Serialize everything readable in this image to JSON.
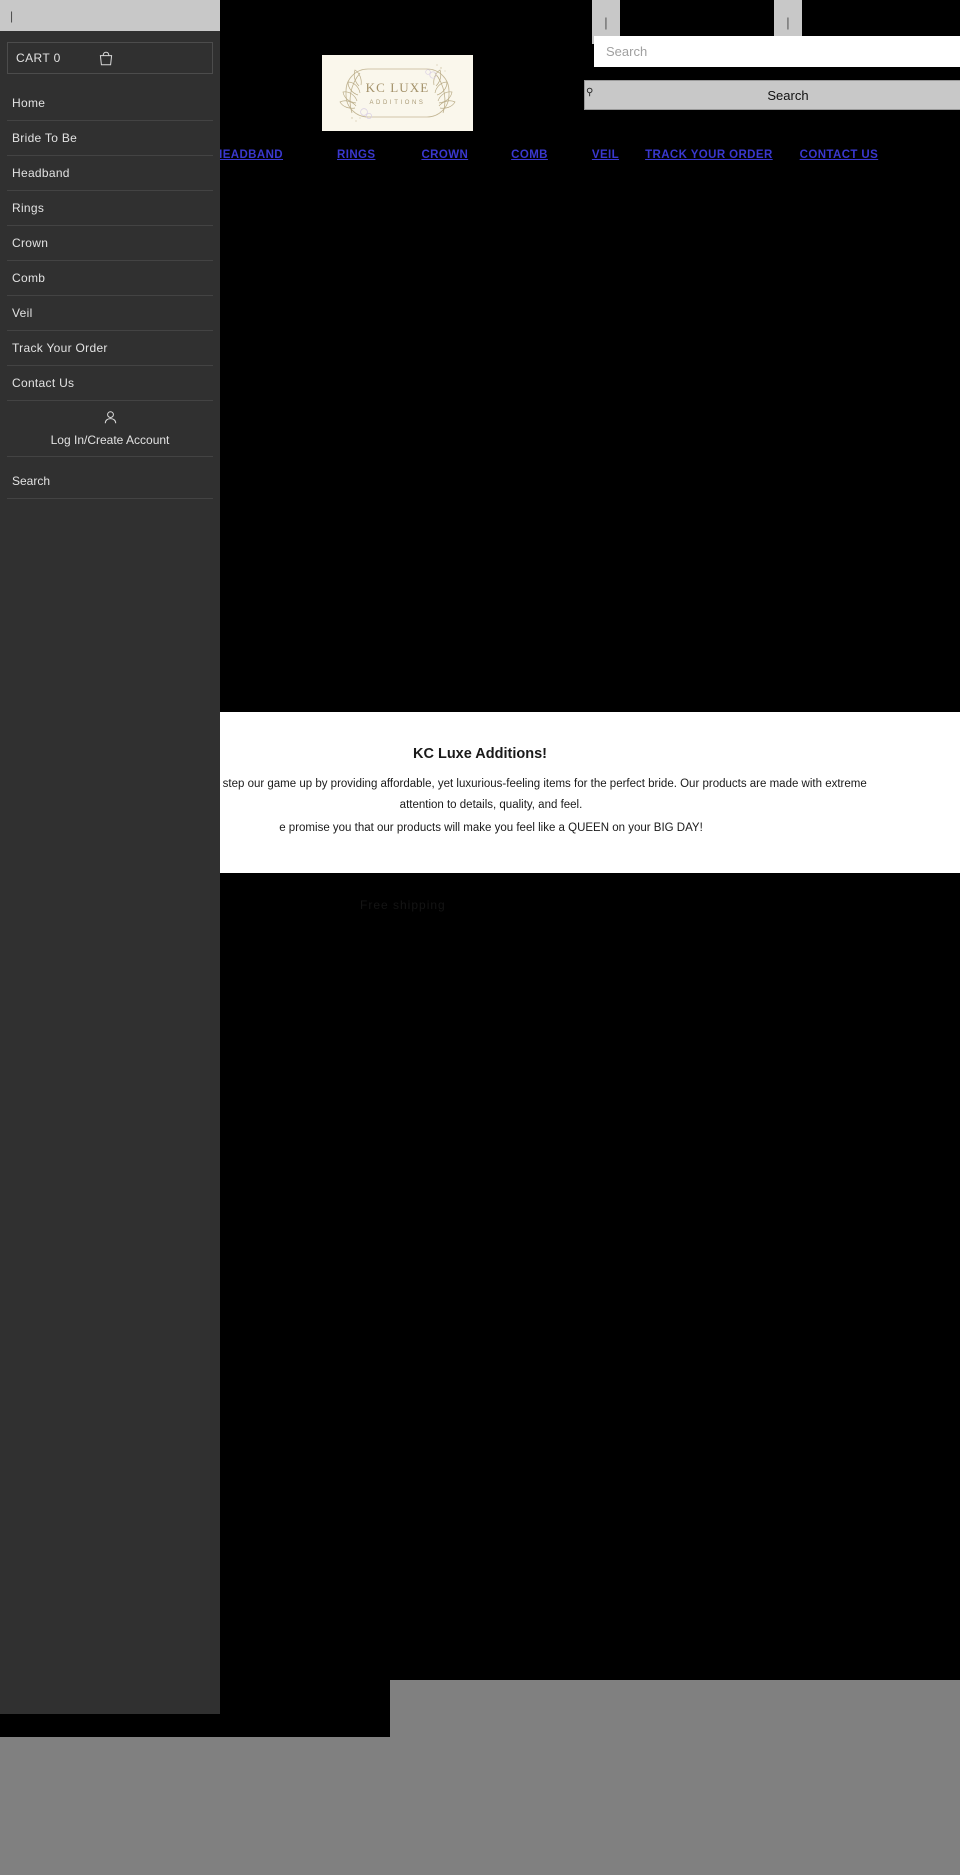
{
  "site": {
    "brand": {
      "logo_line1": "KC LUXE",
      "logo_line2": "ADDITIONS",
      "logo_bg": "#faf7ec",
      "logo_ink": "#b3a88a"
    },
    "search": {
      "placeholder": "Search",
      "value": "",
      "button_label": "Search",
      "button_icon": "magnifier-icon"
    },
    "top_controls": {
      "left_caret": "|",
      "right_caret": "|",
      "drawer_caret": "|"
    },
    "main_nav": {
      "link_color": "#3a38cf",
      "items": [
        {
          "label": "HEADBAND"
        },
        {
          "label": "RINGS"
        },
        {
          "label": "CROWN"
        },
        {
          "label": "COMB"
        },
        {
          "label": "VEIL"
        },
        {
          "label": "TRACK YOUR ORDER"
        },
        {
          "label": "CONTACT US"
        }
      ]
    },
    "about": {
      "title": "KC Luxe Additions!",
      "paragraph_1": "iness, we decided to step our game up by providing affordable, yet luxurious-feeling items for the perfect bride. Our products are made with extreme attention to details, quality, and feel.",
      "paragraph_2": "e promise you that our products will make you feel like a QUEEN on your BIG DAY!"
    },
    "faint_banner": {
      "text": "Free shipping"
    }
  },
  "drawer": {
    "cart": {
      "label": "CART 0",
      "count": "0",
      "icon": "shopping-bag-icon"
    },
    "items": [
      {
        "label": "Home"
      },
      {
        "label": "Bride To Be"
      },
      {
        "label": "Headband"
      },
      {
        "label": "Rings"
      },
      {
        "label": "Crown"
      },
      {
        "label": "Comb"
      },
      {
        "label": "Veil"
      },
      {
        "label": "Track Your Order"
      },
      {
        "label": "Contact Us"
      }
    ],
    "account": {
      "label": "Log In/Create Account",
      "icon": "user-icon"
    },
    "search": {
      "label": "Search"
    }
  }
}
